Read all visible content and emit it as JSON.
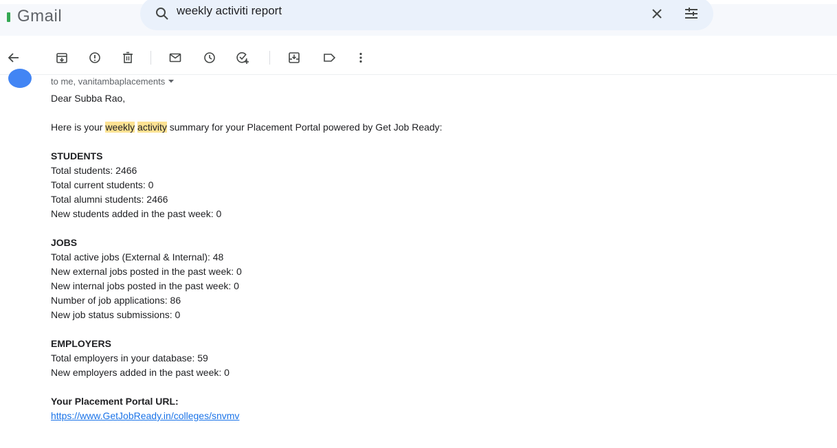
{
  "header": {
    "app_name": "Gmail",
    "search": {
      "value": "weekly activiti report"
    }
  },
  "toolbar": {
    "icons": [
      "back-arrow-icon",
      "archive-icon",
      "report-spam-icon",
      "delete-icon",
      "mark-unread-icon",
      "snooze-icon",
      "add-task-icon",
      "move-to-icon",
      "label-icon",
      "more-vert-icon"
    ]
  },
  "email": {
    "recipients": "to me, vanitambaplacements",
    "greeting": "Dear Subba Rao,",
    "intro": {
      "before": "Here is your ",
      "highlight1": "weekly",
      "space": " ",
      "highlight2": "activity",
      "after": " summary for your Placement Portal powered by Get Job Ready:"
    },
    "students": {
      "title": "STUDENTS",
      "lines": [
        "Total students: 2466",
        "Total current students: 0",
        "Total alumni students: 2466",
        "New students added in the past week: 0"
      ]
    },
    "jobs": {
      "title": "JOBS",
      "lines": [
        "Total active jobs (External & Internal): 48",
        "New external jobs posted in the past week: 0",
        "New internal jobs posted in the past week: 0",
        "Number of job applications: 86",
        "New job status submissions: 0"
      ]
    },
    "employers": {
      "title": "EMPLOYERS",
      "lines": [
        "Total employers in your database: 59",
        "New employers added in the past week: 0"
      ]
    },
    "portal": {
      "title": "Your Placement Portal URL:",
      "url": "https://www.GetJobReady.in/colleges/snvmv"
    }
  },
  "colors": {
    "highlight": "#fde293",
    "link": "#1a73e8",
    "search_bg": "#eaf1fb",
    "header_bg": "#f6f8fc"
  }
}
